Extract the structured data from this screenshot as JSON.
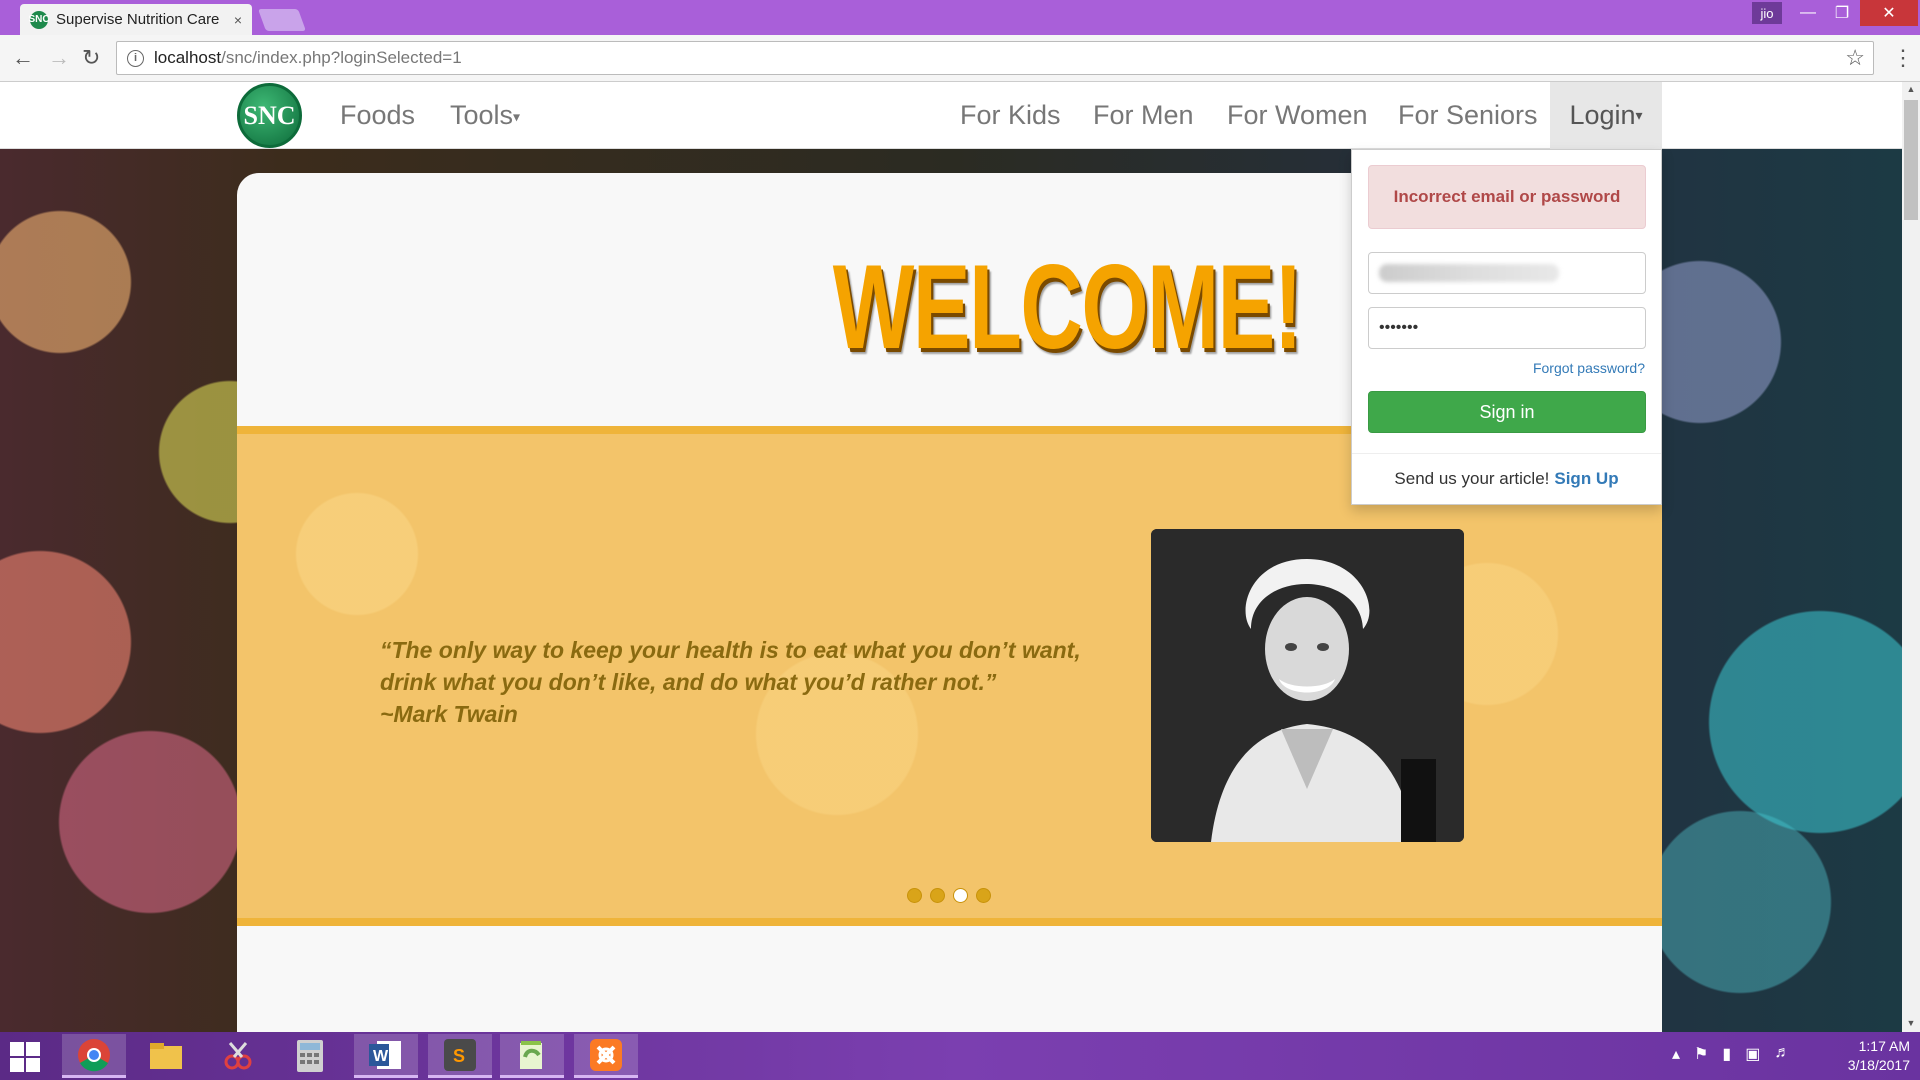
{
  "browser": {
    "tab_title": "Supervise Nutrition Care",
    "tab_favicon": "SNC",
    "tab_close": "×",
    "profile_name": "jio",
    "url_host": "localhost",
    "url_path": "/snc/index.php?loginSelected=1"
  },
  "navbar": {
    "logo_text": "SNC",
    "links": [
      "Foods",
      "Tools",
      "For Kids",
      "For Men",
      "For Women",
      "For Seniors"
    ],
    "login_label": "Login"
  },
  "hero": {
    "welcome": "WELCOME!",
    "quote_line1": "“The only way to keep your health is to eat what you don’t want,",
    "quote_line2": "drink what you don’t like, and do what you’d rather not.”",
    "quote_author": "~Mark Twain",
    "carousel_active_index": 2,
    "carousel_count": 4
  },
  "login": {
    "error": "Incorrect email or password",
    "password_value": "•••••••",
    "forgot": "Forgot password?",
    "signin": "Sign in",
    "footer_text": "Send us your article!",
    "footer_link": "Sign Up"
  },
  "taskbar": {
    "apps": [
      "windows-start",
      "chrome",
      "file-explorer",
      "snipping-tool",
      "calculator",
      "word",
      "sublime-text",
      "notepad-plus",
      "xampp"
    ],
    "time": "1:17 AM",
    "date": "3/18/2017"
  },
  "colors": {
    "titlebar": "#a95fd9",
    "welcome": "#f5a300",
    "banner": "#f3c46a",
    "signin": "#3fa84a",
    "alert_text": "#b04848",
    "link": "#337ab7"
  }
}
